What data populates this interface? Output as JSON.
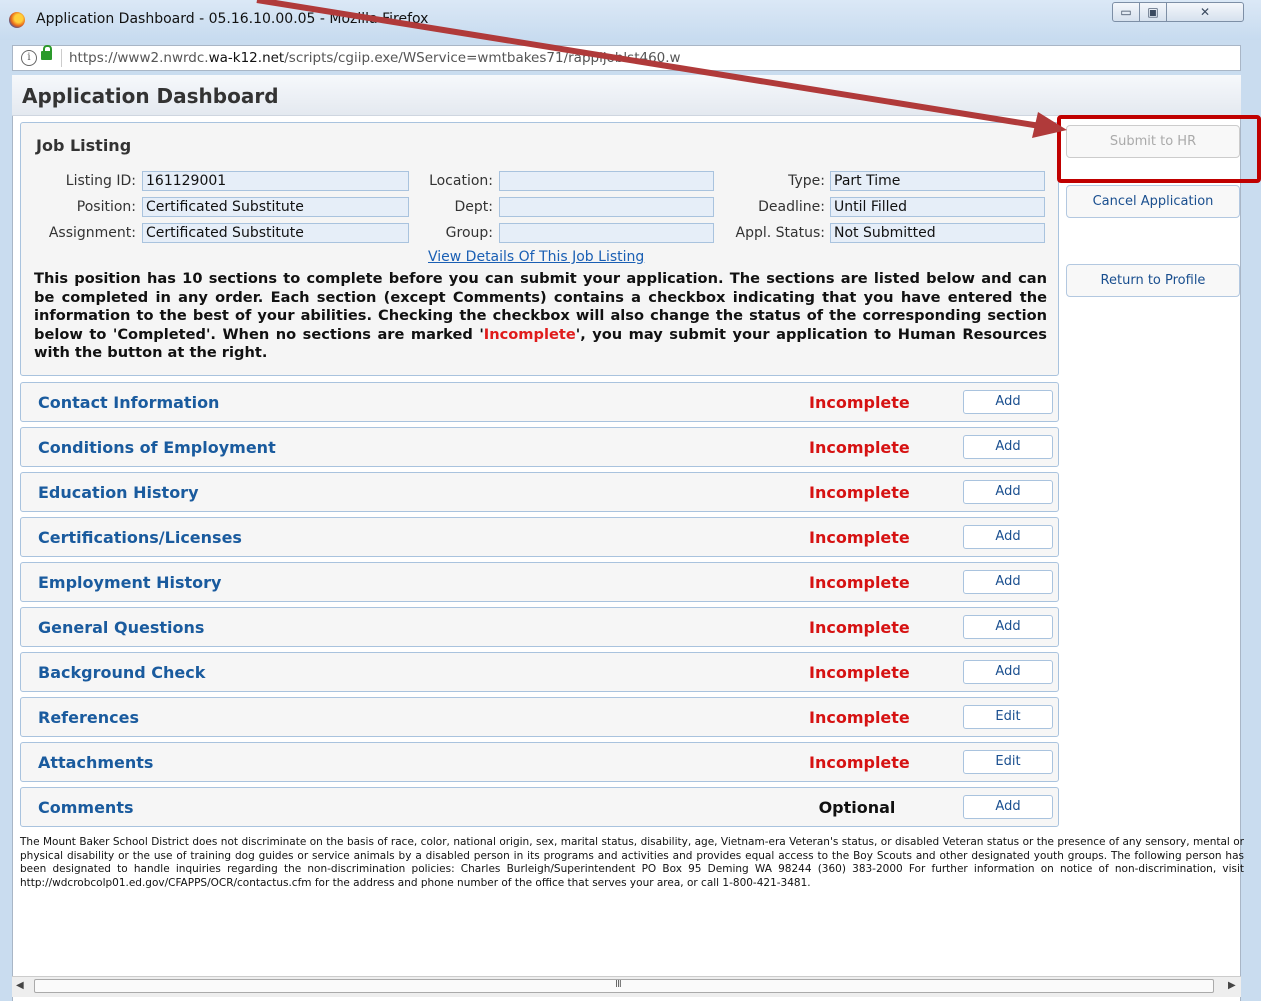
{
  "window": {
    "title": "Application Dashboard - 05.16.10.00.05 - Mozilla Firefox",
    "minimize_symbol": "▭",
    "maximize_symbol": "▣",
    "close_symbol": "✕"
  },
  "browser": {
    "info_symbol": "i",
    "url_prefix": "https://www2.nwrdc.",
    "url_domain": "wa-k12.net",
    "url_suffix": "/scripts/cgiip.exe/WService=wmtbakes71/rappljoblst460.w"
  },
  "page": {
    "title": "Application Dashboard"
  },
  "job_listing": {
    "heading": "Job Listing",
    "fields": {
      "listing_id": {
        "label": "Listing ID:",
        "value": "161129001"
      },
      "position": {
        "label": "Position:",
        "value": "Certificated Substitute"
      },
      "assignment": {
        "label": "Assignment:",
        "value": "Certificated Substitute"
      },
      "location": {
        "label": "Location:",
        "value": ""
      },
      "dept": {
        "label": "Dept:",
        "value": ""
      },
      "group": {
        "label": "Group:",
        "value": ""
      },
      "type": {
        "label": "Type:",
        "value": "Part Time"
      },
      "deadline": {
        "label": "Deadline:",
        "value": "Until Filled"
      },
      "appl_status": {
        "label": "Appl. Status:",
        "value": "Not Submitted"
      }
    },
    "details_link": "View Details Of This Job Listing",
    "description_part1": "This position has 10 sections to complete before you can submit your application. The sections are listed below and can be completed in any order. Each section (except Comments) contains a checkbox indicating that you have entered the information to the best of your abilities. Checking the checkbox will also change the status of the corresponding section below to 'Completed'. When no sections are marked '",
    "description_highlight": "Incomplete",
    "description_part2": "', you may submit your application to Human Resources with the button at the right."
  },
  "actions": {
    "submit": "Submit to HR",
    "cancel": "Cancel Application",
    "return": "Return to Profile"
  },
  "sections": [
    {
      "name": "Contact Information",
      "status": "Incomplete",
      "button": "Add"
    },
    {
      "name": "Conditions of Employment",
      "status": "Incomplete",
      "button": "Add"
    },
    {
      "name": "Education History",
      "status": "Incomplete",
      "button": "Add"
    },
    {
      "name": "Certifications/Licenses",
      "status": "Incomplete",
      "button": "Add"
    },
    {
      "name": "Employment History",
      "status": "Incomplete",
      "button": "Add"
    },
    {
      "name": "General Questions",
      "status": "Incomplete",
      "button": "Add"
    },
    {
      "name": "Background Check",
      "status": "Incomplete",
      "button": "Add"
    },
    {
      "name": "References",
      "status": "Incomplete",
      "button": "Edit"
    },
    {
      "name": "Attachments",
      "status": "Incomplete",
      "button": "Edit"
    },
    {
      "name": "Comments",
      "status": "Optional",
      "button": "Add"
    }
  ],
  "footer": "The Mount Baker School District does not discriminate on the basis of race, color, national origin, sex, marital status, disability, age, Vietnam-era Veteran's status, or disabled Veteran status or the presence of any sensory, mental or physical disability or the use of training dog guides or service animals by a disabled person in its programs and activities and provides equal access to the Boy Scouts and other designated youth groups. The following person has been designated to handle inquiries regarding the non-discrimination policies: Charles Burleigh/Superintendent PO Box 95 Deming WA 98244 (360) 383-2000 For further information on notice of non-discrimination, visit http://wdcrobcolp01.ed.gov/CFAPPS/OCR/contactus.cfm for the address and phone number of the office that serves your area, or call 1-800-421-3481.",
  "scrollbar": {
    "left_arrow": "◀",
    "right_arrow": "▶",
    "grip": "III"
  },
  "colors": {
    "annotation_red": "#c00000",
    "incomplete_red": "#d61212",
    "link_blue": "#1a5b9e"
  }
}
